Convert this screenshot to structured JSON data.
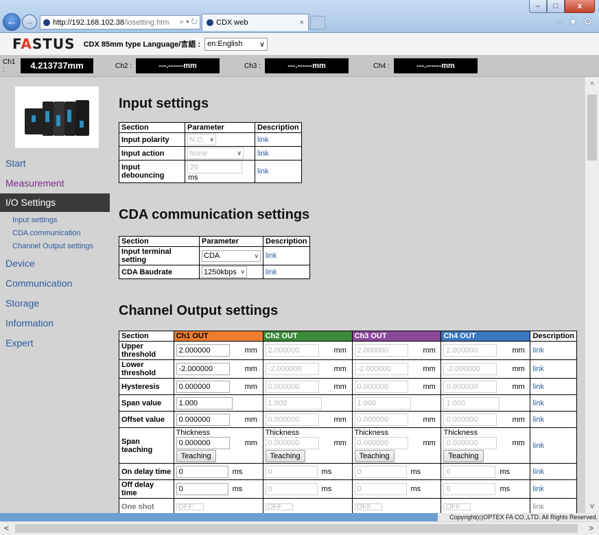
{
  "browser": {
    "url_host": "http://192.168.102.38",
    "url_path": "/iosetting.htm",
    "addr_controls": "⌕ ▾ ↻",
    "tab_title": "CDX web",
    "tab_close": "×",
    "window_controls": {
      "minimize": "–",
      "maximize": "□",
      "close": "x"
    },
    "toolbar_icons": {
      "home": "⌂",
      "favorites": "★",
      "settings": "⚙"
    },
    "back_icon": "←",
    "forward_icon": "→"
  },
  "header": {
    "logo_f": "F",
    "logo_a": "A",
    "logo_rest": "STUS",
    "model_text": "CDX 85mm type  Language/言語 :",
    "language_value": "en:English"
  },
  "channels": {
    "ch1_label": "Ch1 :",
    "ch1_value": "4.213737mm",
    "ch2_label": "Ch2 :",
    "ch2_value": "---.------mm",
    "ch3_label": "Ch3 :",
    "ch3_value": "---.------mm",
    "ch4_label": "Ch4 :",
    "ch4_value": "---.------mm"
  },
  "sidebar": {
    "start": "Start",
    "measurement": "Measurement",
    "io_settings": "I/O Settings",
    "sub_input": "Input settings",
    "sub_cda": "CDA communication",
    "sub_channel": "Channel Output settings",
    "device": "Device",
    "communication": "Communication",
    "storage": "Storage",
    "information": "Information",
    "expert": "Expert"
  },
  "input_settings": {
    "title": "Input settings",
    "col_section": "Section",
    "col_parameter": "Parameter",
    "col_description": "Description",
    "rows": [
      {
        "section": "Input polarity",
        "value": "N.O.",
        "unit": "",
        "link": "link"
      },
      {
        "section": "Input action",
        "value": "None",
        "unit": "",
        "link": "link"
      },
      {
        "section": "Input debouncing",
        "value": "20",
        "unit": "ms",
        "link": "link"
      }
    ]
  },
  "cda_settings": {
    "title": "CDA communication settings",
    "col_section": "Section",
    "col_parameter": "Parameter",
    "col_description": "Description",
    "rows": [
      {
        "section": "Input terminal setting",
        "value": "CDA",
        "link": "link"
      },
      {
        "section": "CDA Baudrate",
        "value": "1250kbps",
        "link": "link"
      }
    ]
  },
  "channel_output": {
    "title": "Channel Output settings",
    "col_section": "Section",
    "col_ch1": "Ch1 OUT",
    "col_ch2": "Ch2 OUT",
    "col_ch3": "Ch3 OUT",
    "col_ch4": "Ch4 OUT",
    "col_description": "Description",
    "unit_mm": "mm",
    "unit_ms": "ms",
    "link": "link",
    "thickness_label": "Thickness",
    "teaching_button": "Teaching",
    "rows": {
      "upper_threshold": {
        "label": "Upper threshold",
        "values": [
          "2.000000",
          "2.000000",
          "2.000000",
          "2.000000"
        ]
      },
      "lower_threshold": {
        "label": "Lower threshold",
        "values": [
          "-2.000000",
          "-2.000000",
          "-2.000000",
          "-2.000000"
        ]
      },
      "hysteresis": {
        "label": "Hysteresis",
        "values": [
          "0.000000",
          "0.000000",
          "0.000000",
          "0.000000"
        ]
      },
      "span_value": {
        "label": "Span value",
        "values": [
          "1.000",
          "1.000",
          "1.000",
          "1.000"
        ]
      },
      "offset_value": {
        "label": "Offset value",
        "values": [
          "0.000000",
          "0.000000",
          "0.000000",
          "0.000000"
        ]
      },
      "span_teaching": {
        "label": "Span teaching",
        "values": [
          "0.000000",
          "0.000000",
          "0.000000",
          "0.000000"
        ]
      },
      "on_delay": {
        "label": "On delay time",
        "values": [
          "0",
          "0",
          "0",
          "0"
        ]
      },
      "off_delay": {
        "label": "Off delay time",
        "values": [
          "0",
          "0",
          "0",
          "0"
        ]
      },
      "one_shot": {
        "label": "One shot",
        "values": [
          "OFF",
          "OFF",
          "OFF",
          "OFF"
        ]
      }
    }
  },
  "copyright": "Copyright(c)OPTEX FA CO.,LTD. All Rights Reserved.",
  "scroll_icons": {
    "up": "^",
    "down": "v",
    "left": "<",
    "right": ">"
  }
}
